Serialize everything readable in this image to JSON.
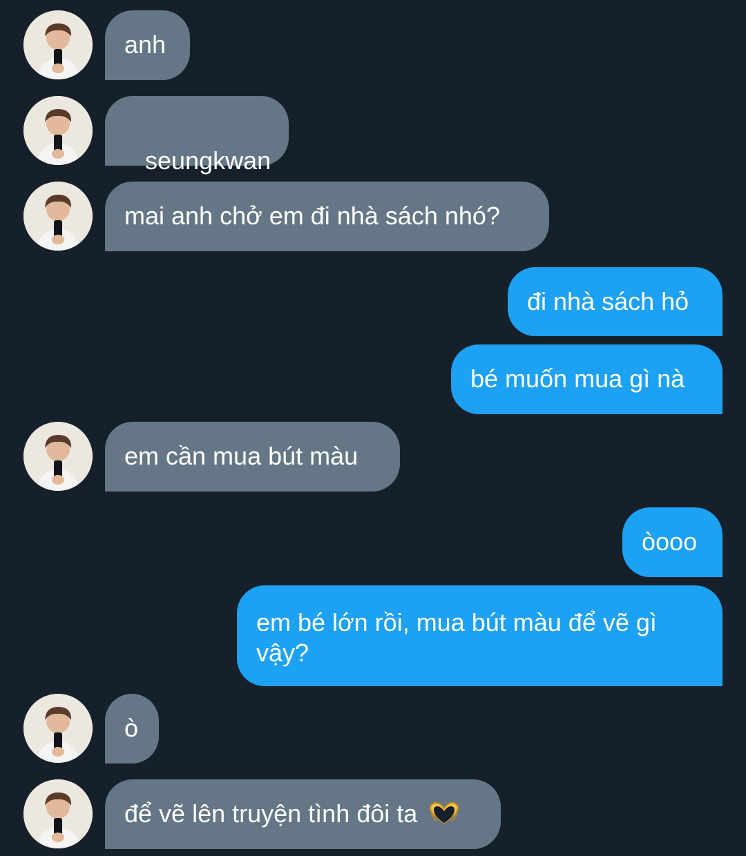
{
  "conversation": {
    "messages": [
      {
        "sender": "them",
        "text": "anh"
      },
      {
        "sender": "them",
        "text": " seungkwan"
      },
      {
        "sender": "them",
        "text": "mai anh chở em đi nhà sách nhó?"
      },
      {
        "sender": "me",
        "text": "đi nhà sách hỏ"
      },
      {
        "sender": "me",
        "text": "bé muốn mua gì nà"
      },
      {
        "sender": "them",
        "text": "em cần mua bút màu"
      },
      {
        "sender": "me",
        "text": "òooo"
      },
      {
        "sender": "me",
        "text": "em bé lớn rồi, mua bút màu để vẽ gì vậy?"
      },
      {
        "sender": "them",
        "text": "ò"
      },
      {
        "sender": "them",
        "text": "để vẽ lên truyện tình đôi ta",
        "emoji": "heart-hands-emoji"
      }
    ]
  },
  "colors": {
    "background": "#15202b",
    "incoming_bubble": "#657786",
    "outgoing_bubble": "#1da1f2",
    "text": "#ffffff"
  }
}
